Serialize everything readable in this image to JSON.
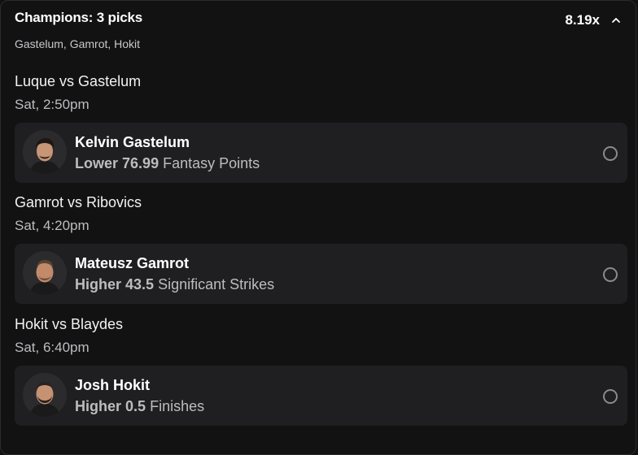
{
  "header": {
    "title": "Champions: 3 picks",
    "subtitle": "Gastelum, Gamrot, Hokit",
    "multiplier": "8.19x"
  },
  "picks": [
    {
      "matchup": "Luque vs Gastelum",
      "time": "Sat, 2:50pm",
      "player": "Kelvin Gastelum",
      "direction": "Lower",
      "line": "76.99",
      "stat": "Fantasy Points"
    },
    {
      "matchup": "Gamrot vs Ribovics",
      "time": "Sat, 4:20pm",
      "player": "Mateusz Gamrot",
      "direction": "Higher",
      "line": "43.5",
      "stat": "Significant Strikes"
    },
    {
      "matchup": "Hokit vs Blaydes",
      "time": "Sat, 6:40pm",
      "player": "Josh Hokit",
      "direction": "Higher",
      "line": "0.5",
      "stat": "Finishes"
    }
  ],
  "icons": {
    "collapse": "chevron-up-icon",
    "select": "radio-icon"
  }
}
